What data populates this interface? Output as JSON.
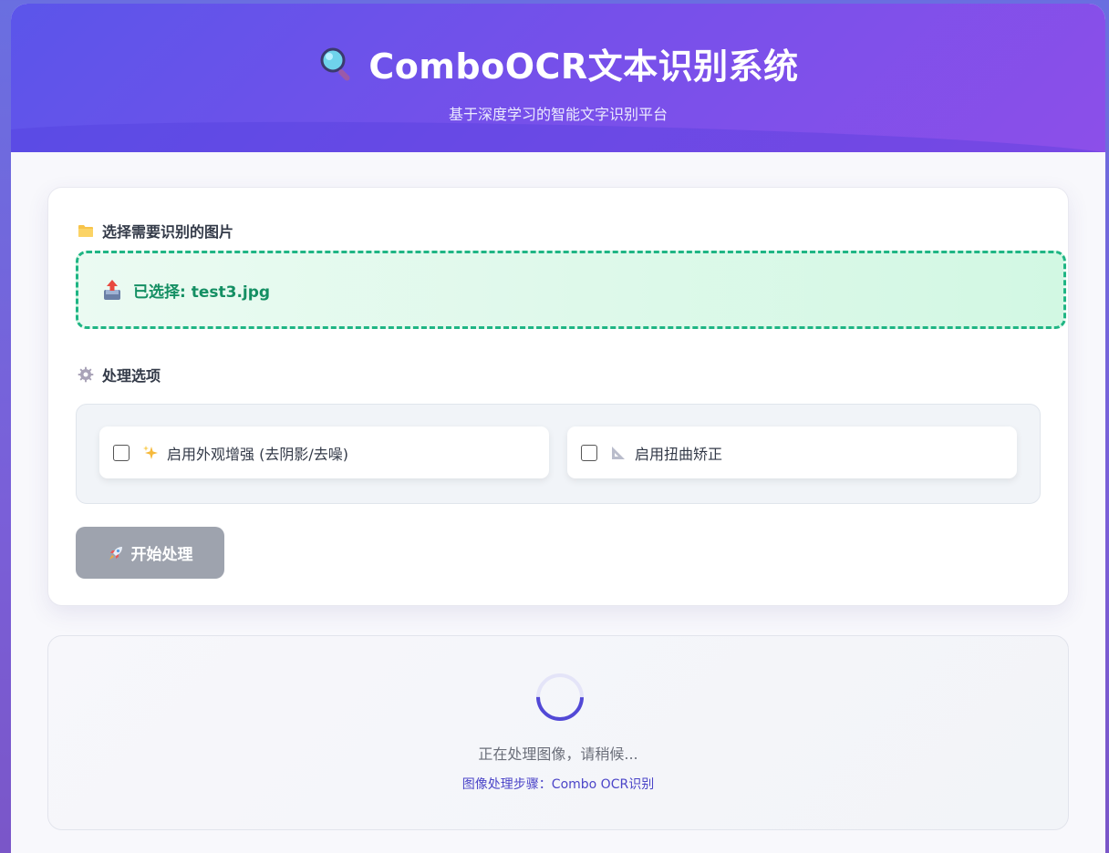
{
  "header": {
    "title": "ComboOCR文本识别系统",
    "subtitle": "基于深度学习的智能文字识别平台",
    "title_icon": "magnifier-icon"
  },
  "upload": {
    "section_label": "选择需要识别的图片",
    "section_icon": "folder-icon",
    "selected_text": "已选择: test3.jpg",
    "upload_icon": "inbox-upload-icon"
  },
  "options": {
    "section_label": "处理选项",
    "section_icon": "gear-icon",
    "items": [
      {
        "label": "启用外观增强 (去阴影/去噪)",
        "icon": "sparkles-icon",
        "checked": false
      },
      {
        "label": "启用扭曲矫正",
        "icon": "triangle-ruler-icon",
        "checked": false
      }
    ]
  },
  "actions": {
    "start_label": "开始处理",
    "start_icon": "rocket-icon",
    "start_enabled": false
  },
  "status": {
    "processing_text": "正在处理图像，请稍候...",
    "step_text": "图像处理步骤：Combo OCR识别"
  },
  "colors": {
    "header_gradient_start": "#5b55ea",
    "header_gradient_end": "#8c4fe9",
    "upload_border": "#1fb584",
    "upload_text": "#148f63",
    "button_disabled": "#9ea3ae",
    "spinner_accent": "#5249d6"
  }
}
